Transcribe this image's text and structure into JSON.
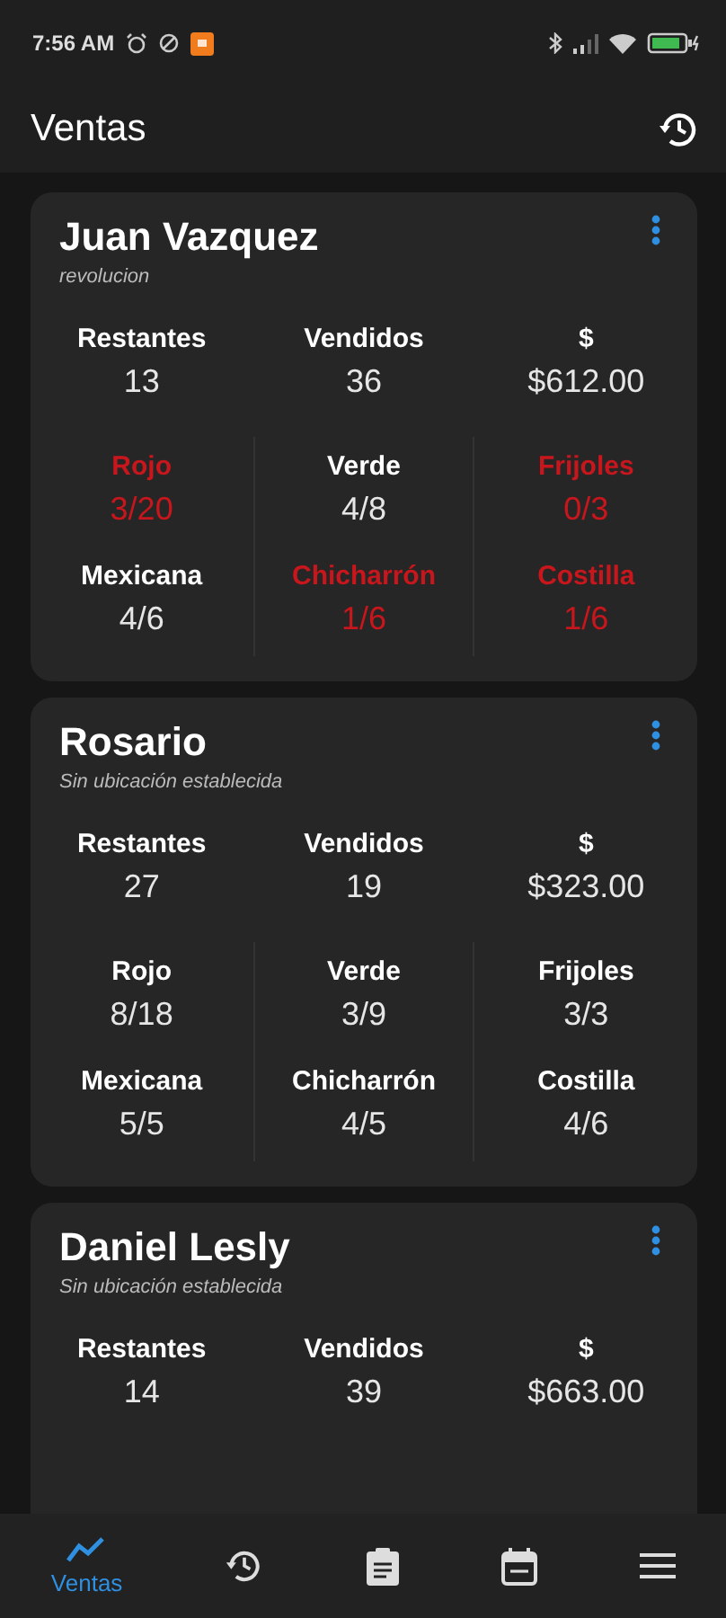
{
  "status_bar": {
    "time": "7:56 AM"
  },
  "app_bar": {
    "title": "Ventas"
  },
  "cards": [
    {
      "name": "Juan Vazquez",
      "location": "revolucion",
      "stats": [
        {
          "label": "Restantes",
          "value": "13"
        },
        {
          "label": "Vendidos",
          "value": "36"
        },
        {
          "label": "$",
          "value": "$612.00"
        }
      ],
      "items": [
        {
          "label": "Rojo",
          "value": "3/20",
          "low": true
        },
        {
          "label": "Verde",
          "value": "4/8",
          "low": false
        },
        {
          "label": "Frijoles",
          "value": "0/3",
          "low": true
        },
        {
          "label": "Mexicana",
          "value": "4/6",
          "low": false
        },
        {
          "label": "Chicharrón",
          "value": "1/6",
          "low": true
        },
        {
          "label": "Costilla",
          "value": "1/6",
          "low": true
        }
      ]
    },
    {
      "name": "Rosario",
      "location": "Sin ubicación establecida",
      "stats": [
        {
          "label": "Restantes",
          "value": "27"
        },
        {
          "label": "Vendidos",
          "value": "19"
        },
        {
          "label": "$",
          "value": "$323.00"
        }
      ],
      "items": [
        {
          "label": "Rojo",
          "value": "8/18",
          "low": false
        },
        {
          "label": "Verde",
          "value": "3/9",
          "low": false
        },
        {
          "label": "Frijoles",
          "value": "3/3",
          "low": false
        },
        {
          "label": "Mexicana",
          "value": "5/5",
          "low": false
        },
        {
          "label": "Chicharrón",
          "value": "4/5",
          "low": false
        },
        {
          "label": "Costilla",
          "value": "4/6",
          "low": false
        }
      ]
    },
    {
      "name": "Daniel Lesly",
      "location": "Sin ubicación establecida",
      "stats": [
        {
          "label": "Restantes",
          "value": "14"
        },
        {
          "label": "Vendidos",
          "value": "39"
        },
        {
          "label": "$",
          "value": "$663.00"
        }
      ]
    }
  ],
  "nav": [
    {
      "label": "Ventas",
      "selected": true
    },
    {
      "selected": false
    },
    {
      "selected": false
    },
    {
      "selected": false
    },
    {
      "selected": false
    }
  ]
}
